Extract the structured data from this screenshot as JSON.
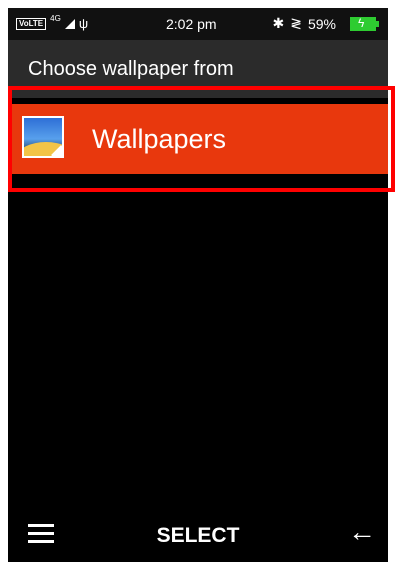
{
  "status_bar": {
    "volte": "VoLTE",
    "network": "4G",
    "time": "2:02 pm",
    "battery_text": "59%",
    "battery_color": "#2ecc31"
  },
  "header": {
    "title": "Choose wallpaper from"
  },
  "list": {
    "items": [
      {
        "label": "Wallpapers",
        "icon": "wallpaper-icon",
        "highlight_color": "#e8380d"
      }
    ]
  },
  "softkeys": {
    "left_icon": "menu-icon",
    "center_label": "SELECT",
    "right_icon": "back-arrow-icon"
  }
}
